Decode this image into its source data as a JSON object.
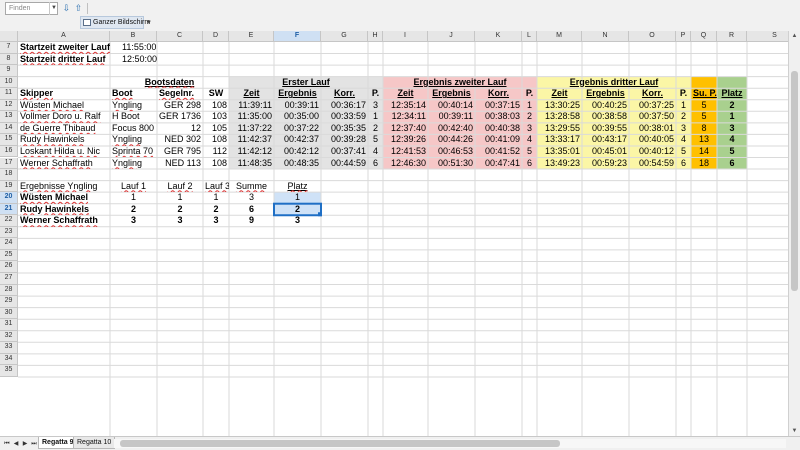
{
  "toolbar": {
    "find_placeholder": "Finden",
    "fullscreen_label": "Ganzer Bildschirm"
  },
  "selected": {
    "col": "F",
    "row": "21"
  },
  "columns": [
    "A",
    "B",
    "C",
    "D",
    "E",
    "F",
    "G",
    "H",
    "I",
    "J",
    "K",
    "L",
    "M",
    "N",
    "O",
    "P",
    "Q",
    "R",
    "S"
  ],
  "rows": [
    "7",
    "8",
    "9",
    "10",
    "11",
    "12",
    "13",
    "14",
    "15",
    "16",
    "17",
    "18",
    "19",
    "20",
    "21",
    "22",
    "23",
    "24",
    "25",
    "26",
    "27",
    "28",
    "29",
    "30",
    "31",
    "32",
    "33",
    "34",
    "35"
  ],
  "cells": {
    "A7": "Startzeit zweiter Lauf",
    "B7": "11:55:00",
    "A8": "Startzeit dritter Lauf",
    "B8": "12:50:00",
    "B10": "Bootsdaten",
    "E10": "Erster Lauf",
    "I10": "Ergebnis zweiter Lauf",
    "M10": "Ergebnis dritter Lauf",
    "A11": "Skipper",
    "B11": "Boot",
    "C11": "Segelnr.",
    "D11": "SW",
    "E11": "Zeit",
    "F11": "Ergebnis",
    "G11": "Korr.",
    "H11": "P.",
    "I11": "Zeit",
    "J11": "Ergebnis",
    "K11": "Korr.",
    "L11": "P.",
    "M11": "Zeit",
    "N11": "Ergebnis",
    "O11": "Korr.",
    "P11": "P.",
    "Q11": "Su. P.",
    "R11": "Platz",
    "A12": "Wüsten Michael",
    "B12": "Yngling",
    "C12": "GER 298",
    "D12": "108",
    "E12": "11:39:11",
    "F12": "00:39:11",
    "G12": "00:36:17",
    "H12": "3",
    "I12": "12:35:14",
    "J12": "00:40:14",
    "K12": "00:37:15",
    "L12": "1",
    "M12": "13:30:25",
    "N12": "00:40:25",
    "O12": "00:37:25",
    "P12": "1",
    "Q12": "5",
    "R12": "2",
    "A13": "Vollmer Doro u. Ralf",
    "B13": "H Boot",
    "C13": "GER 1736",
    "D13": "103",
    "E13": "11:35:00",
    "F13": "00:35:00",
    "G13": "00:33:59",
    "H13": "1",
    "I13": "12:34:11",
    "J13": "00:39:11",
    "K13": "00:38:03",
    "L13": "2",
    "M13": "13:28:58",
    "N13": "00:38:58",
    "O13": "00:37:50",
    "P13": "2",
    "Q13": "5",
    "R13": "1",
    "A14": "de Guerre Thibaud",
    "B14": "Focus 800",
    "C14": "12",
    "D14": "105",
    "E14": "11:37:22",
    "F14": "00:37:22",
    "G14": "00:35:35",
    "H14": "2",
    "I14": "12:37:40",
    "J14": "00:42:40",
    "K14": "00:40:38",
    "L14": "3",
    "M14": "13:29:55",
    "N14": "00:39:55",
    "O14": "00:38:01",
    "P14": "3",
    "Q14": "8",
    "R14": "3",
    "A15": "Rudy Hawinkels",
    "B15": "Yngling",
    "C15": "NED 302",
    "D15": "108",
    "E15": "11:42:37",
    "F15": "00:42:37",
    "G15": "00:39:28",
    "H15": "5",
    "I15": "12:39:26",
    "J15": "00:44:26",
    "K15": "00:41:09",
    "L15": "4",
    "M15": "13:33:17",
    "N15": "00:43:17",
    "O15": "00:40:05",
    "P15": "4",
    "Q15": "13",
    "R15": "4",
    "A16": "Loskant Hilda u. Nic",
    "B16": "Sprinta 70",
    "C16": "GER 795",
    "D16": "112",
    "E16": "11:42:12",
    "F16": "00:42:12",
    "G16": "00:37:41",
    "H16": "4",
    "I16": "12:41:53",
    "J16": "00:46:53",
    "K16": "00:41:52",
    "L16": "5",
    "M16": "13:35:01",
    "N16": "00:45:01",
    "O16": "00:40:12",
    "P16": "5",
    "Q16": "14",
    "R16": "5",
    "A17": "Werner Schaffrath",
    "B17": "Yngling",
    "C17": "NED 113",
    "D17": "108",
    "E17": "11:48:35",
    "F17": "00:48:35",
    "G17": "00:44:59",
    "H17": "6",
    "I17": "12:46:30",
    "J17": "00:51:30",
    "K17": "00:47:41",
    "L17": "6",
    "M17": "13:49:23",
    "N17": "00:59:23",
    "O17": "00:54:59",
    "P17": "6",
    "Q17": "18",
    "R17": "6",
    "A19": "Ergebnisse Yngling",
    "B19": "Lauf 1",
    "C19": "Lauf 2",
    "D19": "Lauf 3",
    "E19": "Summe",
    "F19": "Platz",
    "A20": "Wüsten Michael",
    "B20": "1",
    "C20": "1",
    "D20": "1",
    "E20": "3",
    "F20": "1",
    "A21": "Rudy Hawinkels",
    "B21": "2",
    "C21": "2",
    "D21": "2",
    "E21": "6",
    "F21": "2",
    "A22": "Werner Schaffrath",
    "B22": "3",
    "C22": "3",
    "D22": "3",
    "E22": "9",
    "F22": "3"
  },
  "colors": {
    "erster_lauf": "#e3e3e3",
    "zweiter_lauf": "#f6c7c7",
    "dritter_lauf": "#fbf6a6",
    "summe_punkte": "#ffc000",
    "platz": "#a9d08e",
    "selection": "#cfe2f7",
    "cursor": "#1f6fc5"
  },
  "sheets": [
    {
      "name": "Regatta 9",
      "active": true
    },
    {
      "name": "Regatta 10",
      "active": false
    }
  ]
}
